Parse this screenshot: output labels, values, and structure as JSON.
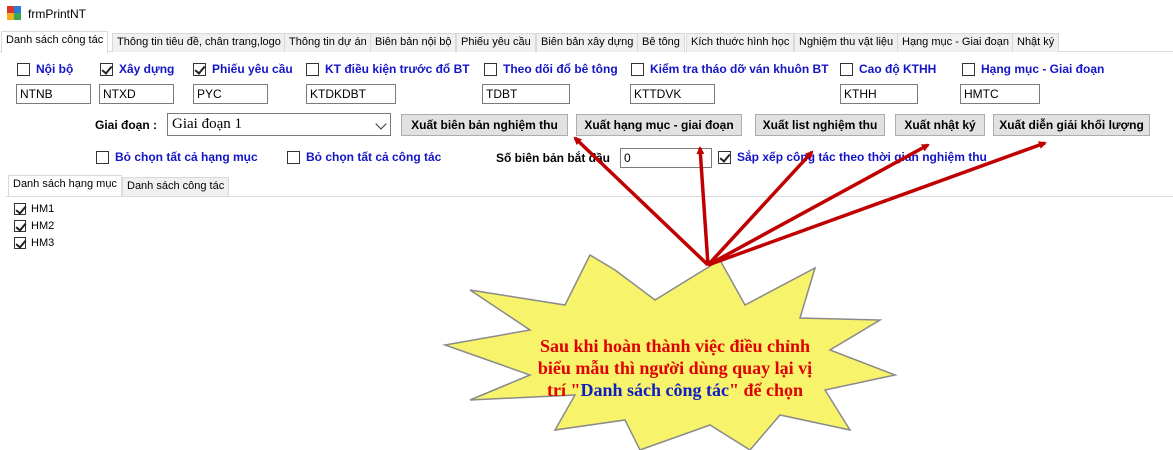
{
  "window": {
    "title": "frmPrintNT"
  },
  "tabs": [
    "Danh sách công tác",
    "Thông tin tiêu đề, chân trang,logo",
    "Thông tin dự án",
    "Biên bản nội bộ",
    "Phiếu yêu cầu",
    "Biên bản xây dựng",
    "Bê tông",
    "Kích thuớc hình học",
    "Nghiệm thu vật liệu",
    "Hạng mục - Giai đoạn",
    "Nhật ký"
  ],
  "checkboxes": [
    {
      "label": "Nội bộ",
      "checked": false,
      "code": "NTNB"
    },
    {
      "label": "Xây dựng",
      "checked": true,
      "code": "NTXD"
    },
    {
      "label": "Phiếu yêu cầu",
      "checked": true,
      "code": "PYC"
    },
    {
      "label": "KT điều kiện trước đổ BT",
      "checked": false,
      "code": "KTDKDBT"
    },
    {
      "label": "Theo dõi đổ bê tông",
      "checked": false,
      "code": "TDBT"
    },
    {
      "label": "Kiểm tra tháo dỡ ván khuôn BT",
      "checked": false,
      "code": "KTTDVK"
    },
    {
      "label": "Cao độ KTHH",
      "checked": false,
      "code": "KTHH"
    },
    {
      "label": "Hạng mục - Giai đoạn",
      "checked": false,
      "code": "HMTC"
    }
  ],
  "stage": {
    "label": "Giai đoạn :",
    "value": "Giai đoạn 1"
  },
  "buttons": [
    "Xuất biên bản nghiệm thu",
    "Xuất hạng mục - giai đoạn",
    "Xuất list nghiệm thu",
    "Xuất nhật ký",
    "Xuất diễn giải khối lượng"
  ],
  "options": {
    "deselect_all_items": "Bỏ chọn tất cả hạng mục",
    "deselect_all_tasks": "Bỏ chọn tất cả công tác",
    "start_number_label": "Số biên bản bắt đầu",
    "start_number_value": "0",
    "sort_by_time": "Sắp xếp công tác theo thời gian nghiệm thu",
    "sort_checked": true
  },
  "subtabs": [
    "Danh sách hạng mục",
    "Danh sách công tác"
  ],
  "items": [
    {
      "label": "HM1",
      "checked": true
    },
    {
      "label": "HM2",
      "checked": true
    },
    {
      "label": "HM3",
      "checked": true
    }
  ],
  "callout": {
    "line1": "Sau khi hoàn thành việc điều chỉnh",
    "line2": "biểu mẫu thì người dùng quay lại vị",
    "line3_pre": "trí \"",
    "line3_hl": "Danh sách công tác",
    "line3_post": "\" để chọn"
  },
  "colors": {
    "label_blue": "#1414c8",
    "callout_fill": "#f7f36a",
    "arrow_red": "#c00000"
  }
}
